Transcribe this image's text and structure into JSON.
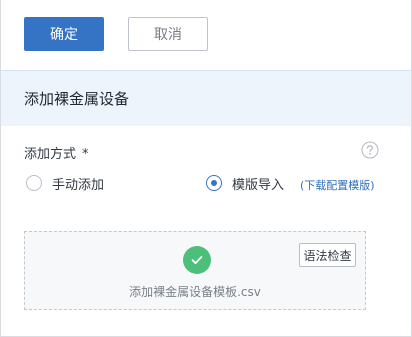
{
  "toolbar": {
    "confirm_label": "确定",
    "cancel_label": "取消"
  },
  "section": {
    "title": "添加裸金属设备"
  },
  "add_method": {
    "label": "添加方式",
    "required_mark": "*",
    "options": [
      {
        "label": "手动添加",
        "selected": false
      },
      {
        "label": "模版导入",
        "selected": true
      }
    ],
    "download_link": "(下载配置模版)"
  },
  "upload": {
    "file_name": "添加裸金属设备模板.csv",
    "syntax_check_label": "语法检查",
    "status_icon": "check-icon"
  },
  "colors": {
    "primary": "#3574c4",
    "success": "#4cbf7a",
    "header_bg": "#eef4fb"
  }
}
